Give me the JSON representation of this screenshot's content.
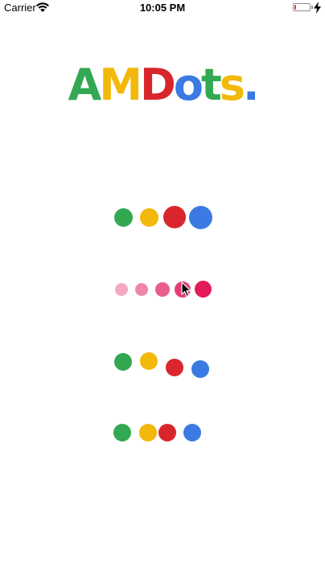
{
  "status_bar": {
    "carrier": "Carrier",
    "time": "10:05 PM",
    "battery_color": "#e0352e"
  },
  "logo": {
    "letters": [
      {
        "char": "A",
        "color": "#33a852"
      },
      {
        "char": "M",
        "color": "#f2b80a"
      },
      {
        "char": "D",
        "color": "#d9262c"
      },
      {
        "char": "o",
        "color": "#3b7ae2"
      },
      {
        "char": "t",
        "color": "#33a852"
      },
      {
        "char": "s",
        "color": "#f2b80a"
      },
      {
        "char": ".",
        "color": "#3b7ae2"
      }
    ]
  },
  "colors": {
    "green": "#33a852",
    "yellow": "#f2b80a",
    "red": "#d9262c",
    "blue": "#3b7ae2",
    "pink_1": "#f3a9c2",
    "pink_2": "#ef86a8",
    "pink_3": "#ea5e8c",
    "pink_4": "#e53d73",
    "pink_5": "#e21c58"
  }
}
